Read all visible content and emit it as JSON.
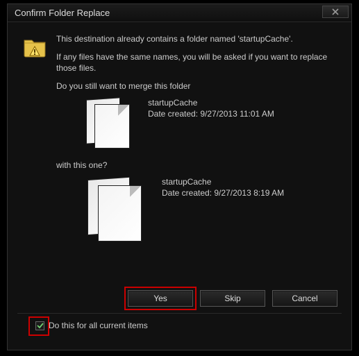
{
  "dialog": {
    "title": "Confirm Folder Replace",
    "message1": "This destination already contains a folder named 'startupCache'.",
    "message2": "If any files have the same names, you will be asked if you want to replace those files.",
    "question": "Do you still want to merge this folder",
    "with_line": "with this one?",
    "source_folder": {
      "name": "startupCache",
      "date_line": "Date created: 9/27/2013 11:01 AM"
    },
    "dest_folder": {
      "name": "startupCache",
      "date_line": "Date created: 9/27/2013 8:19 AM"
    },
    "buttons": {
      "yes": "Yes",
      "skip": "Skip",
      "cancel": "Cancel"
    },
    "checkbox_label": "Do this for all current items",
    "checkbox_checked": true
  }
}
